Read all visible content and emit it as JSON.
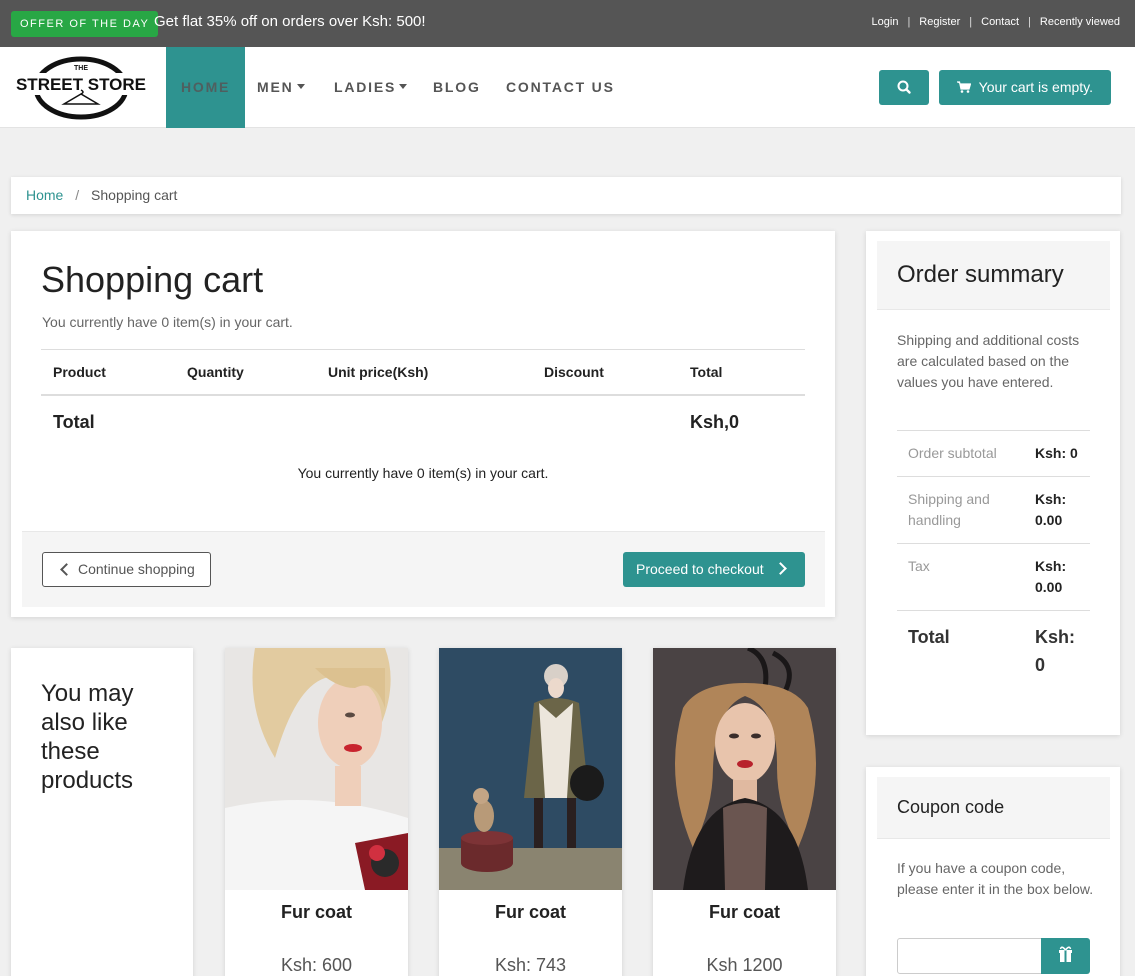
{
  "topbar": {
    "offer_badge": "Offer of the day",
    "offer_text": "Get flat 35% off on orders over Ksh: 500!",
    "links": [
      "Login",
      "Register",
      "Contact",
      "Recently viewed"
    ],
    "separator": "|"
  },
  "navbar": {
    "logo_small": "THE",
    "logo_text": "STREET STORE",
    "items": [
      {
        "label": "Home",
        "active": true
      },
      {
        "label": "Men",
        "dropdown": true
      },
      {
        "label": "Ladies",
        "dropdown": true
      },
      {
        "label": "Blog"
      },
      {
        "label": "Contact us"
      }
    ],
    "search_icon": "search-icon",
    "cart_label": "Your cart is empty.",
    "accent_color": "#2e9390"
  },
  "breadcrumb": {
    "home": "Home",
    "separator": "/",
    "current": "Shopping cart"
  },
  "cart": {
    "title": "Shopping cart",
    "subtitle": "You currently have 0 item(s) in your cart.",
    "columns": [
      "Product",
      "Quantity",
      "Unit price(Ksh)",
      "Discount",
      "Total"
    ],
    "total_label": "Total",
    "total_value": "Ksh,0",
    "empty_message": "You currently have 0 item(s) in your cart.",
    "continue_label": "Continue shopping",
    "checkout_label": "Proceed to checkout"
  },
  "summary": {
    "title": "Order summary",
    "description": "Shipping and additional costs are calculated based on the values you have entered.",
    "rows": [
      {
        "label": "Order subtotal",
        "value": "Ksh: 0"
      },
      {
        "label": "Shipping and handling",
        "value": "Ksh: 0.00"
      },
      {
        "label": "Tax",
        "value": "Ksh: 0.00"
      }
    ],
    "total_label": "Total",
    "total_value": "Ksh: 0"
  },
  "coupon": {
    "title": "Coupon code",
    "description": "If you have a coupon code, please enter it in the box below.",
    "input_value": "",
    "button_icon": "gift-icon"
  },
  "also_like": {
    "heading": "You may also like these products",
    "products": [
      {
        "name": "Fur coat",
        "price": "Ksh: 600"
      },
      {
        "name": "Fur coat",
        "price": "Ksh: 743"
      },
      {
        "name": "Fur coat",
        "price": "Ksh 1200"
      }
    ]
  }
}
